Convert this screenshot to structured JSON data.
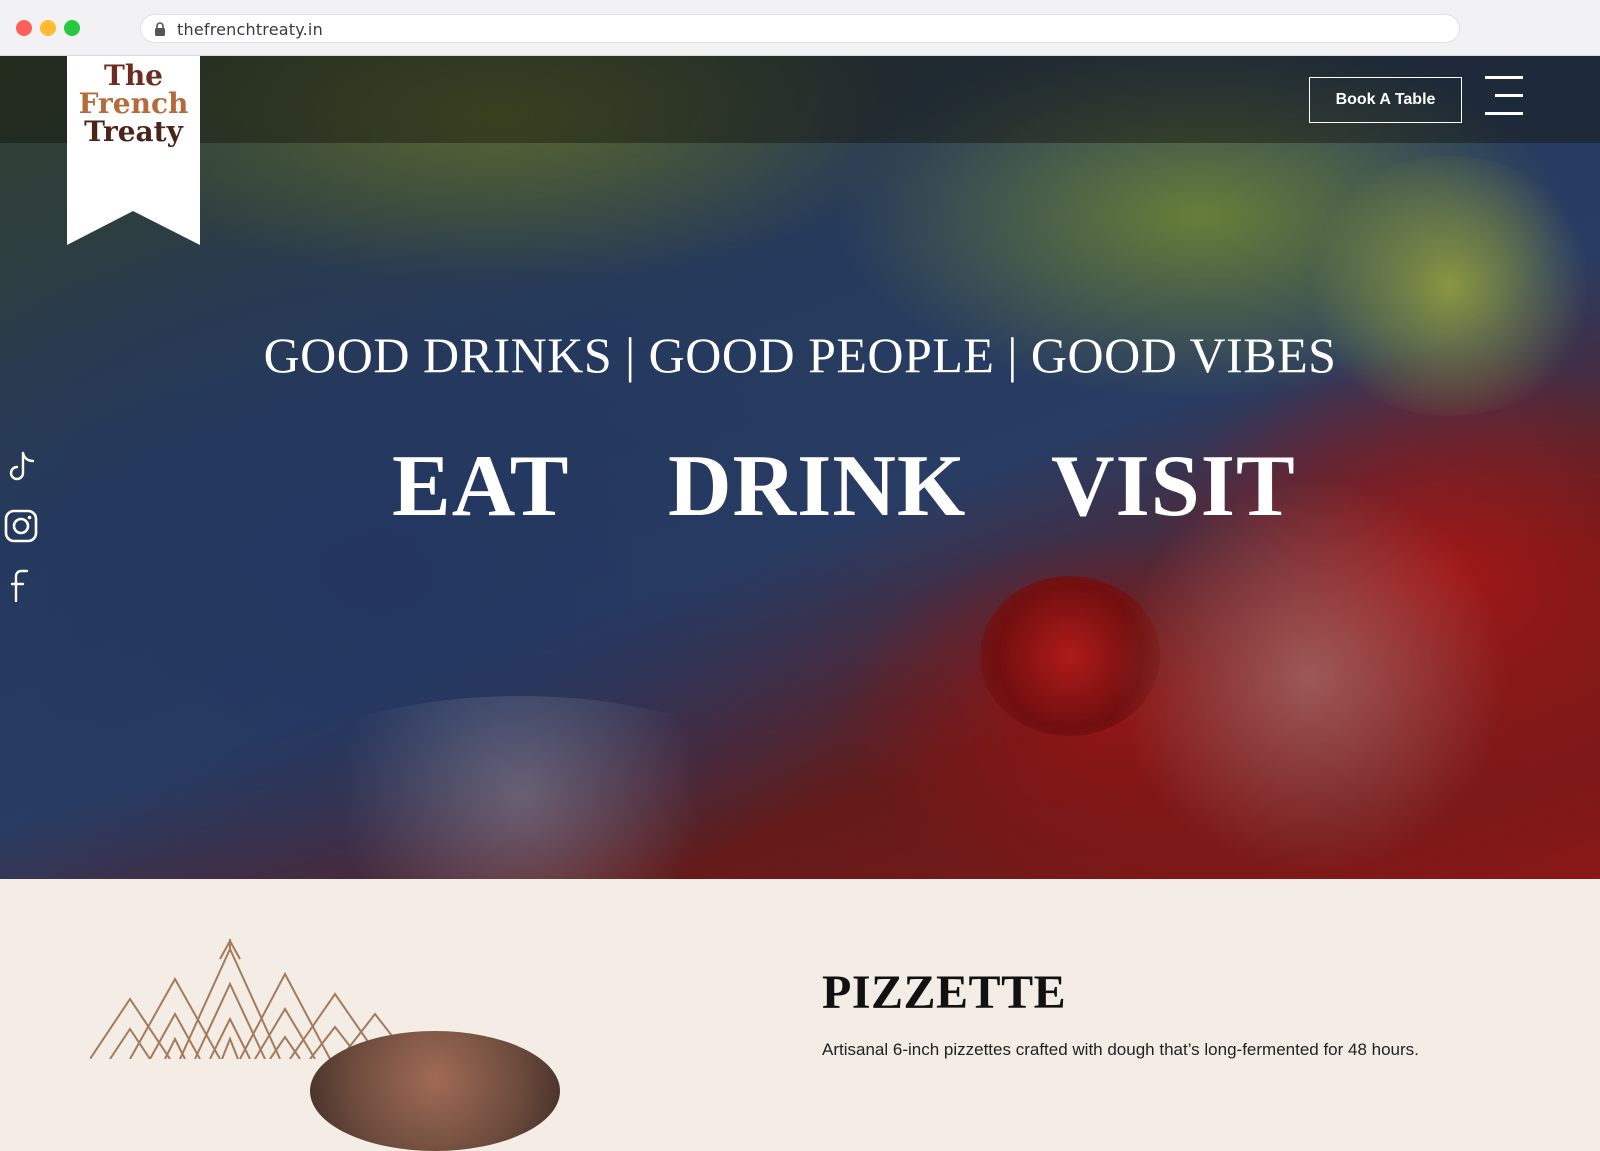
{
  "browser": {
    "url": "thefrenchtreaty.in"
  },
  "header": {
    "logo": {
      "line1": "The",
      "line2": "French",
      "line3": "Treaty"
    },
    "book_label": "Book A Table"
  },
  "hero": {
    "tagline": "GOOD DRINKS | GOOD PEOPLE | GOOD VIBES",
    "nav": [
      "EAT",
      "DRINK",
      "VISIT"
    ]
  },
  "social": [
    "tiktok-icon",
    "instagram-icon",
    "facebook-icon"
  ],
  "section": {
    "title": "PIZZETTE",
    "description": "Artisanal 6-inch pizzettes crafted with dough that’s long-fermented for 48 hours."
  },
  "colors": {
    "cream": "#f3ede6",
    "logo_brown": "#6b2e1e",
    "logo_copper": "#b56a3a",
    "deco_line": "#a47a5a"
  }
}
